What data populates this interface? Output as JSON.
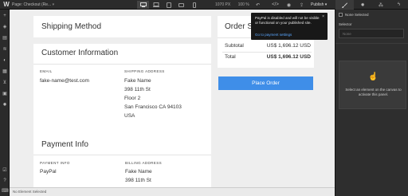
{
  "topbar": {
    "page_label": "Page: Checkout (Re...",
    "width_readout": "1070 PX",
    "zoom_readout": "100 %",
    "publish_label": "Publish"
  },
  "left_tools": {
    "icons": [
      "add-icon",
      "cube-icon",
      "pages-icon",
      "layers-icon",
      "paint-icon",
      "database-icon",
      "cart-icon",
      "media-icon",
      "settings-icon"
    ],
    "bottom_icons": [
      "check-icon",
      "help-icon",
      "keyboard-icon"
    ]
  },
  "shipping_method": {
    "title": "Shipping Method"
  },
  "customer_info": {
    "title": "Customer Information",
    "email_label": "EMAIL",
    "email_value": "fake-name@test.com",
    "address_label": "SHIPPING ADDRESS",
    "address_lines": [
      "Fake Name",
      "398 11th St",
      "Floor 2",
      "San Francisco CA 94103",
      "USA"
    ]
  },
  "payment_info": {
    "title": "Payment Info",
    "payment_label": "PAYMENT INFO",
    "payment_value": "PayPal",
    "billing_label": "BILLING ADDRESS",
    "billing_lines": [
      "Fake Name",
      "398 11th St"
    ]
  },
  "order_summary": {
    "title": "Order S",
    "subtotal_label": "Subtotal",
    "subtotal_value": "US$ 1,696.12 USD",
    "total_label": "Total",
    "total_value": "US$ 1,696.12 USD",
    "place_order_label": "Place Order"
  },
  "tooltip": {
    "text": "PayPal is disabled and will not be visible or functional on your published site.",
    "link": "Go to payment settings",
    "close": "×"
  },
  "statusbar": {
    "text": "No Element Selected"
  },
  "right_panel": {
    "tabs": [
      "brush-icon",
      "gear-icon",
      "drops-icon",
      "bolt-icon"
    ],
    "none_selected": "None Selected",
    "selector_label": "Selector",
    "selector_placeholder": "None",
    "empty_text": "Select an element on the canvas to activate this panel."
  }
}
